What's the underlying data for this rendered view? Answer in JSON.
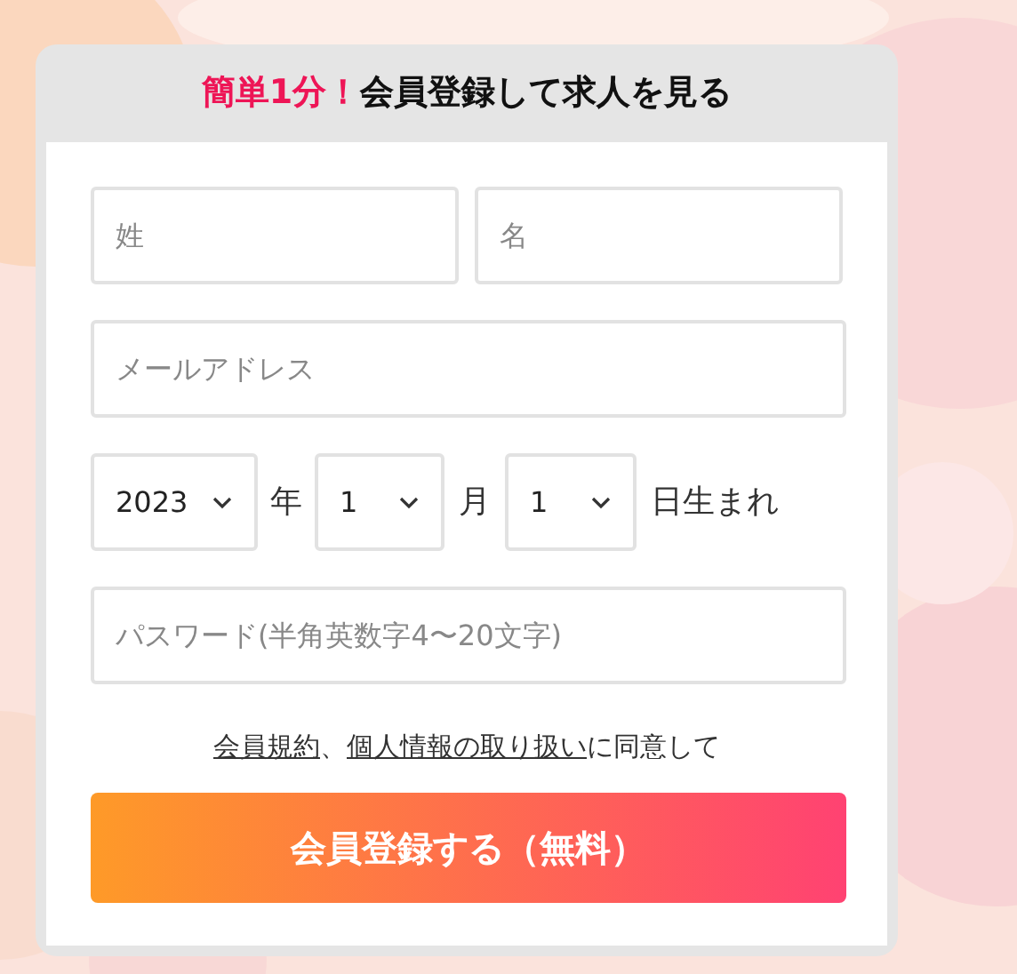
{
  "header": {
    "highlight": "簡単1分！",
    "title": "会員登録して求人を見る"
  },
  "name_fields": [
    {
      "placeholder": "姓"
    },
    {
      "placeholder": "名"
    }
  ],
  "email_field": {
    "placeholder": "メールアドレス"
  },
  "birthday": {
    "year": {
      "value": "2023",
      "unit": "年"
    },
    "month": {
      "value": "1",
      "unit": "月"
    },
    "day": {
      "value": "1",
      "unit": "日生まれ"
    }
  },
  "password_field": {
    "placeholder": "パスワード(半角英数字4〜20文字)"
  },
  "agreement": {
    "links": [
      "会員規約",
      "個人情報の取り扱い"
    ],
    "separator": "、",
    "text": "に同意して"
  },
  "submit_button": {
    "label": "会員登録する（無料）"
  }
}
